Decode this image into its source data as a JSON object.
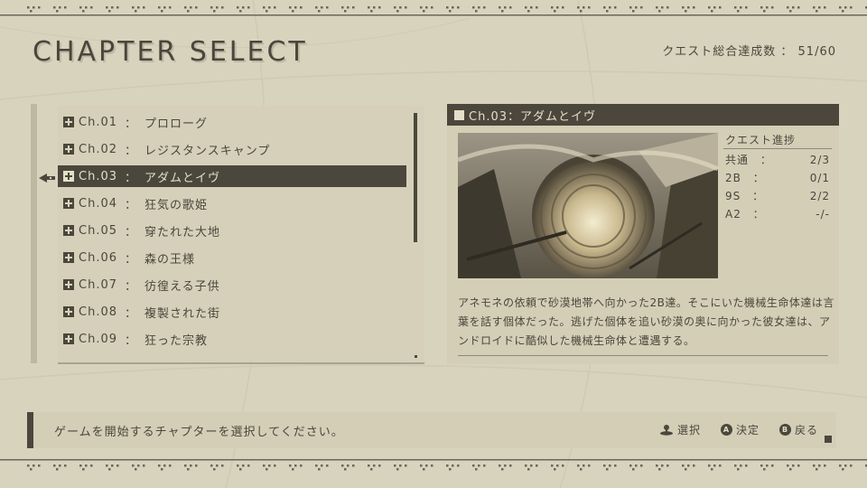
{
  "screen": {
    "title": "CHAPTER SELECT",
    "quest_total_label": "クエスト総合達成数",
    "quest_total_separator": "：",
    "quest_total_value": "51/60"
  },
  "chapters": [
    {
      "number": "Ch.01",
      "separator": "：",
      "name": "プロローグ"
    },
    {
      "number": "Ch.02",
      "separator": "：",
      "name": "レジスタンスキャンプ"
    },
    {
      "number": "Ch.03",
      "separator": "：",
      "name": "アダムとイヴ"
    },
    {
      "number": "Ch.04",
      "separator": "：",
      "name": "狂気の歌姫"
    },
    {
      "number": "Ch.05",
      "separator": "：",
      "name": "穿たれた大地"
    },
    {
      "number": "Ch.06",
      "separator": "：",
      "name": "森の王様"
    },
    {
      "number": "Ch.07",
      "separator": "：",
      "name": "彷徨える子供"
    },
    {
      "number": "Ch.08",
      "separator": "：",
      "name": "複製された街"
    },
    {
      "number": "Ch.09",
      "separator": "：",
      "name": "狂った宗教"
    }
  ],
  "selected_index": 2,
  "detail": {
    "header": "Ch.03：アダムとイヴ",
    "quest_progress_title": "クエスト進捗",
    "quests": [
      {
        "label": "共通",
        "separator": "：",
        "value": "2/3"
      },
      {
        "label": "2B",
        "separator": "：",
        "value": "0/1"
      },
      {
        "label": "9S",
        "separator": "：",
        "value": "2/2"
      },
      {
        "label": "A2",
        "separator": "：",
        "value": "-/-"
      }
    ],
    "description": "アネモネの依頼で砂漠地帯へ向かった2B達。そこにいた機械生命体達は言葉を話す個体だった。逃げた個体を追い砂漠の奥に向かった彼女達は、アンドロイドに酷似した機械生命体と遭遇する。"
  },
  "help": {
    "message": "ゲームを開始するチャプターを選択してください。",
    "controls": [
      {
        "icon": "analog-stick-icon",
        "button": "",
        "label": "選択"
      },
      {
        "icon": "a-button-icon",
        "button": "A",
        "label": "決定"
      },
      {
        "icon": "b-button-icon",
        "button": "B",
        "label": "戻る"
      }
    ]
  },
  "colors": {
    "background": "#d8d3bd",
    "panel": "#d4ceb7",
    "dark": "#4b473c",
    "highlight_text": "#e4dfc8"
  }
}
